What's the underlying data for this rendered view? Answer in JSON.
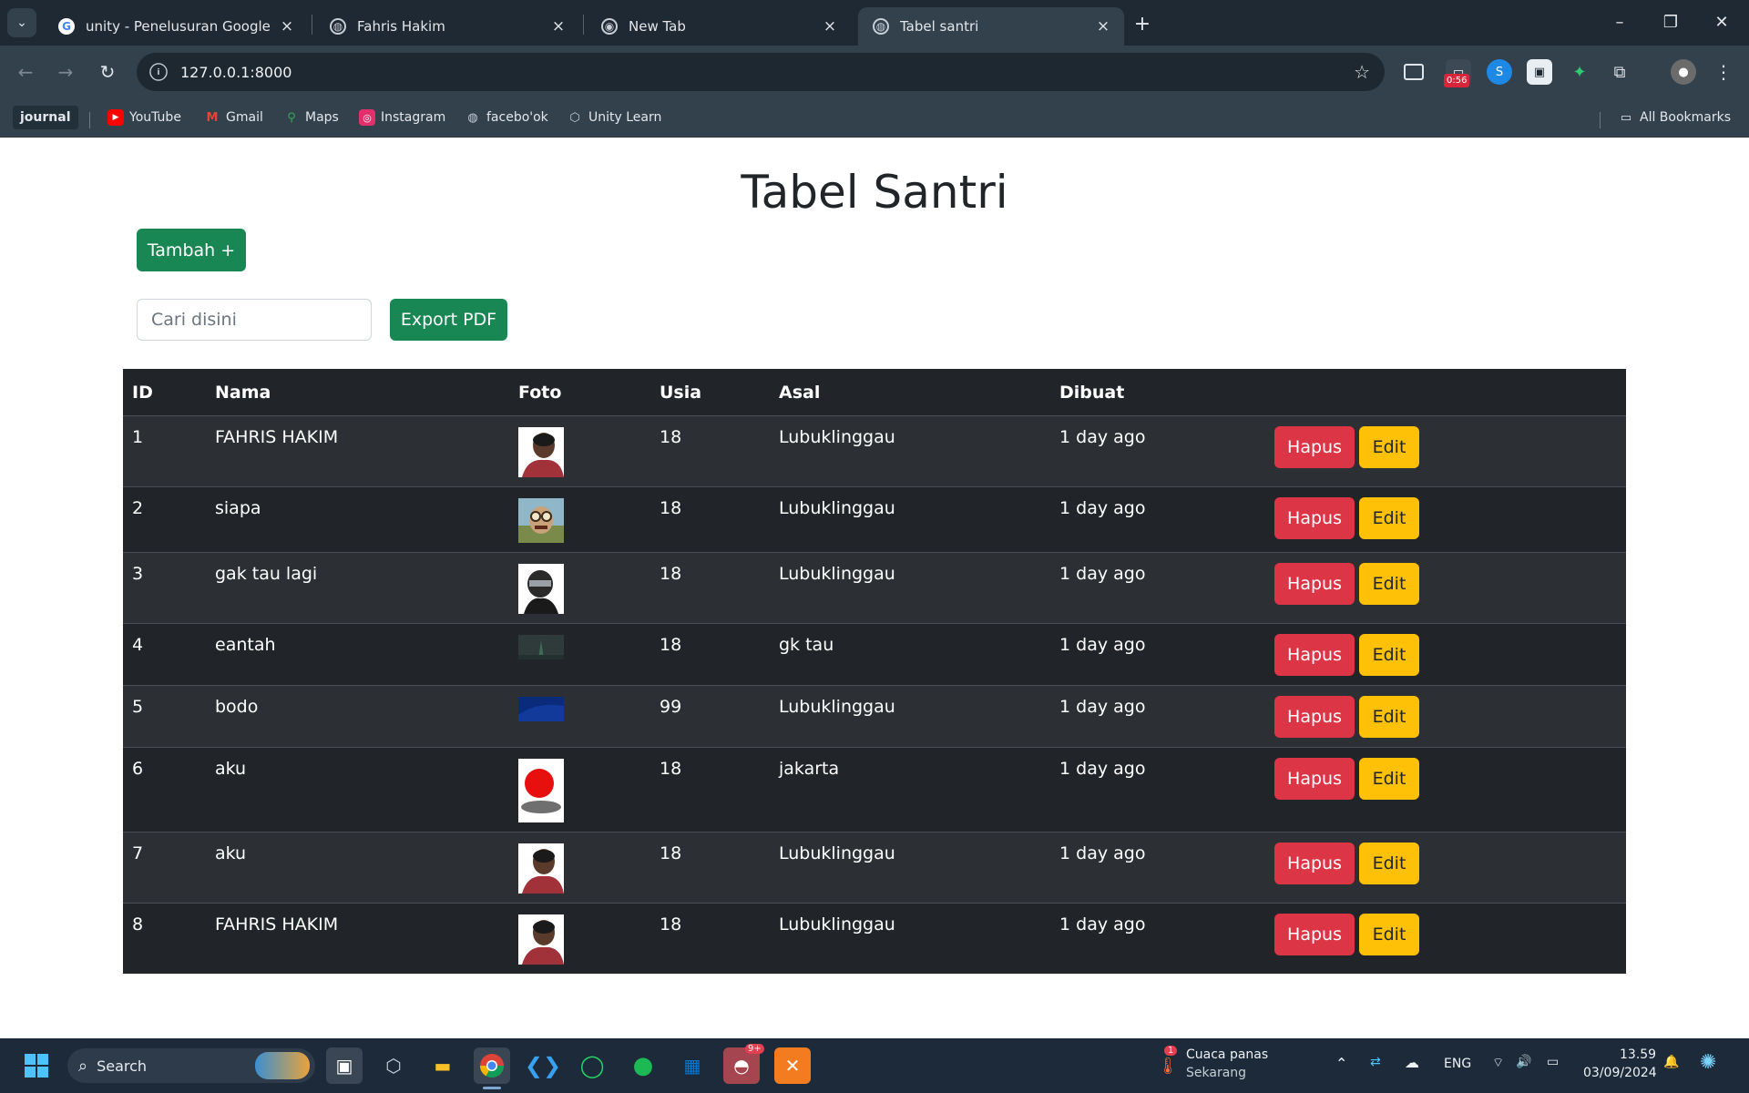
{
  "browser": {
    "tabs": [
      {
        "title": "unity - Penelusuran Google",
        "favicon": "google-icon",
        "active": false
      },
      {
        "title": "Fahris Hakim",
        "favicon": "globe-icon",
        "active": false
      },
      {
        "title": "New Tab",
        "favicon": "chrome-icon",
        "active": false
      },
      {
        "title": "Tabel santri",
        "favicon": "globe-icon",
        "active": true
      }
    ],
    "url": "127.0.0.1:8000",
    "extension_badge": "0:56",
    "bookmarks": [
      {
        "label": "journal"
      },
      {
        "label": "YouTube",
        "icon": "youtube-icon",
        "color": "#ff0000"
      },
      {
        "label": "Gmail",
        "icon": "gmail-icon",
        "color": "#ea4335"
      },
      {
        "label": "Maps",
        "icon": "maps-icon",
        "color": "#34a853"
      },
      {
        "label": "Instagram",
        "icon": "instagram-icon",
        "color": "#e1306c"
      },
      {
        "label": "facebo'ok",
        "icon": "globe-icon"
      },
      {
        "label": "Unity Learn",
        "icon": "unity-icon"
      }
    ],
    "all_bookmarks": "All Bookmarks"
  },
  "page": {
    "title": "Tabel Santri",
    "add_button": "Tambah +",
    "search_placeholder": "Cari disini",
    "export_button": "Export PDF",
    "columns": [
      "ID",
      "Nama",
      "Foto",
      "Usia",
      "Asal",
      "Dibuat"
    ],
    "rows": [
      {
        "id": "1",
        "nama": "FAHRIS HAKIM",
        "foto": "person-photo",
        "usia": "18",
        "asal": "Lubuklinggau",
        "dibuat": "1 day ago"
      },
      {
        "id": "2",
        "nama": "siapa",
        "foto": "meme-photo",
        "usia": "18",
        "asal": "Lubuklinggau",
        "dibuat": "1 day ago"
      },
      {
        "id": "3",
        "nama": "gak tau lagi",
        "foto": "helmet-photo",
        "usia": "18",
        "asal": "Lubuklinggau",
        "dibuat": "1 day ago"
      },
      {
        "id": "4",
        "nama": "eantah",
        "foto": "dark-landscape-photo",
        "usia": "18",
        "asal": "gk tau",
        "dibuat": "1 day ago"
      },
      {
        "id": "5",
        "nama": "bodo",
        "foto": "blue-wallpaper-photo",
        "usia": "99",
        "asal": "Lubuklinggau",
        "dibuat": "1 day ago"
      },
      {
        "id": "6",
        "nama": "aku",
        "foto": "red-ball-photo",
        "usia": "18",
        "asal": "jakarta",
        "dibuat": "1 day ago"
      },
      {
        "id": "7",
        "nama": "aku",
        "foto": "person-photo",
        "usia": "18",
        "asal": "Lubuklinggau",
        "dibuat": "1 day ago"
      },
      {
        "id": "8",
        "nama": "FAHRIS HAKIM",
        "foto": "person-photo",
        "usia": "18",
        "asal": "Lubuklinggau",
        "dibuat": "1 day ago"
      }
    ],
    "delete_label": "Hapus",
    "edit_label": "Edit",
    "colors": {
      "success": "#198754",
      "danger": "#dc3545",
      "warning": "#ffc107",
      "table_dark": "#212529"
    }
  },
  "taskbar": {
    "search_label": "Search",
    "weather_title": "Cuaca panas",
    "weather_sub": "Sekarang",
    "weather_badge": "1",
    "discord_badge": "9+",
    "language": "ENG",
    "time": "13.59",
    "date": "03/09/2024"
  }
}
